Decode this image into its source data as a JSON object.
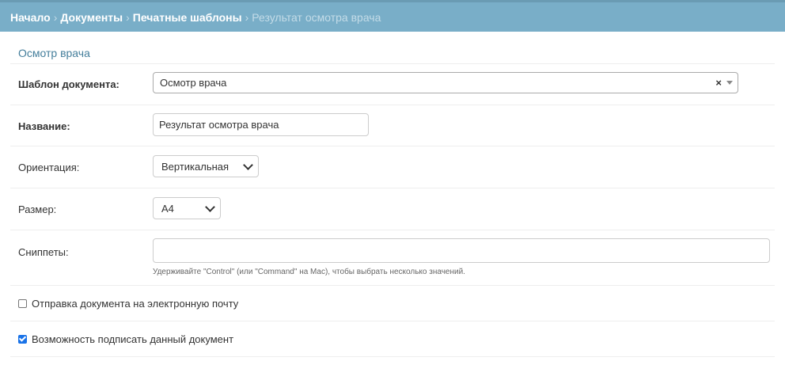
{
  "breadcrumbs": {
    "home": "Начало",
    "documents": "Документы",
    "templates": "Печатные шаблоны",
    "current": "Результат осмотра врача",
    "separator": "›"
  },
  "fieldset": {
    "title": "Осмотр врача"
  },
  "form": {
    "template": {
      "label": "Шаблон документа:",
      "value": "Осмотр врача",
      "clear": "×"
    },
    "name": {
      "label": "Название:",
      "value": "Результат осмотра врача"
    },
    "orientation": {
      "label": "Ориентация:",
      "value": "Вертикальная"
    },
    "size": {
      "label": "Размер:",
      "value": "A4"
    },
    "snippets": {
      "label": "Сниппеты:",
      "help": "Удерживайте \"Control\" (или \"Command\" на Mac), чтобы выбрать несколько значений."
    },
    "send_email": {
      "label": "Отправка документа на электронную почту",
      "checked": false
    },
    "can_sign": {
      "label": "Возможность подписать данный документ",
      "checked": true
    }
  },
  "colors": {
    "header_bg": "#79aec8",
    "fieldset_title": "#447e9b",
    "checkbox_checked": "#1a73e8"
  }
}
